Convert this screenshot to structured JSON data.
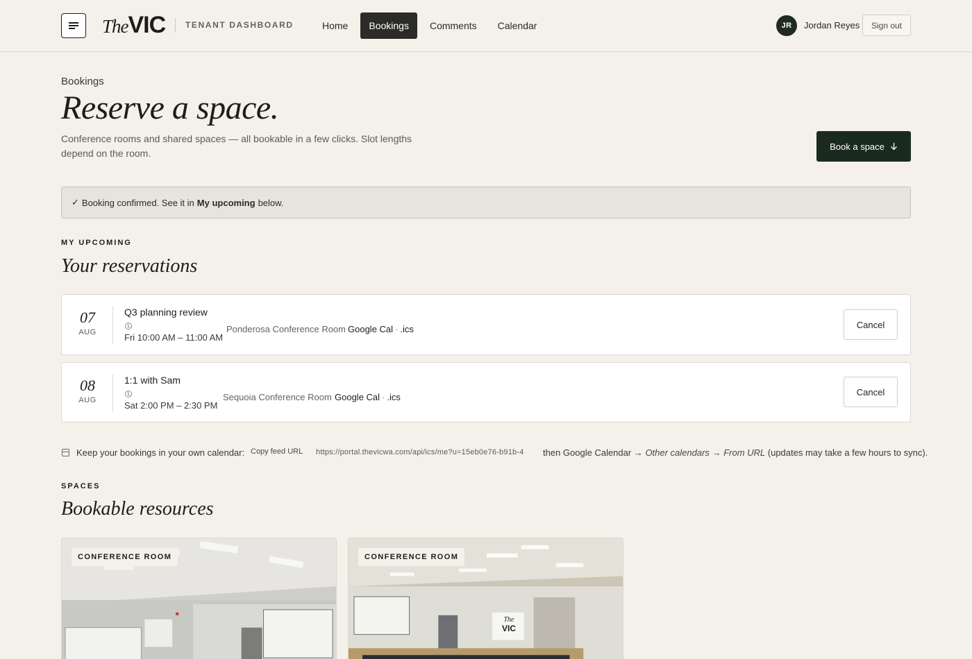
{
  "header": {
    "logo_the": "The",
    "logo_vic": "VIC",
    "dashboard_label": "TENANT DASHBOARD",
    "nav": [
      {
        "label": "Home",
        "active": false
      },
      {
        "label": "Bookings",
        "active": true
      },
      {
        "label": "Comments",
        "active": false
      },
      {
        "label": "Calendar",
        "active": false
      }
    ],
    "user_initials": "JR",
    "user_name": "Jordan Reyes",
    "signout_label": "Sign out"
  },
  "hero": {
    "breadcrumb": "Bookings",
    "title": "Reserve a space.",
    "subtitle": "Conference rooms and shared spaces — all bookable in a few clicks. Slot lengths depend on the room.",
    "book_button": "Book a space"
  },
  "alert": {
    "check": "✓",
    "prefix": "Booking confirmed. See it in",
    "link": "My upcoming",
    "suffix": "below."
  },
  "upcoming": {
    "eyebrow": "MY UPCOMING",
    "title": "Your reservations",
    "items": [
      {
        "day": "07",
        "month": "AUG",
        "title": "Q3 planning review",
        "time": "Fri 10:00 AM – 11:00 AM",
        "room": "Ponderosa Conference Room",
        "gcal": "Google Cal",
        "ics": ".ics",
        "cancel": "Cancel"
      },
      {
        "day": "08",
        "month": "AUG",
        "title": "1:1 with Sam",
        "time": "Sat 2:00 PM – 2:30 PM",
        "room": "Sequoia Conference Room",
        "gcal": "Google Cal",
        "ics": ".ics",
        "cancel": "Cancel"
      }
    ]
  },
  "feed": {
    "text": "Keep your bookings in your own calendar:",
    "copy_label": "Copy feed URL",
    "url": "https://portal.thevicwa.com/api/ics/me?u=15eb0e76-b91b-4",
    "then": "then Google Calendar →",
    "other": "Other calendars",
    "arrow": "→",
    "from": "From URL",
    "note": "(updates may take a few hours to sync)."
  },
  "spaces": {
    "eyebrow": "SPACES",
    "title": "Bookable resources",
    "cards": [
      {
        "badge": "CONFERENCE ROOM"
      },
      {
        "badge": "CONFERENCE ROOM",
        "sign_the": "The",
        "sign_vic": "VIC"
      }
    ]
  },
  "colors": {
    "background": "#f4f0ea",
    "primary": "#1b2a1f",
    "nav_active": "#2b2b29"
  }
}
